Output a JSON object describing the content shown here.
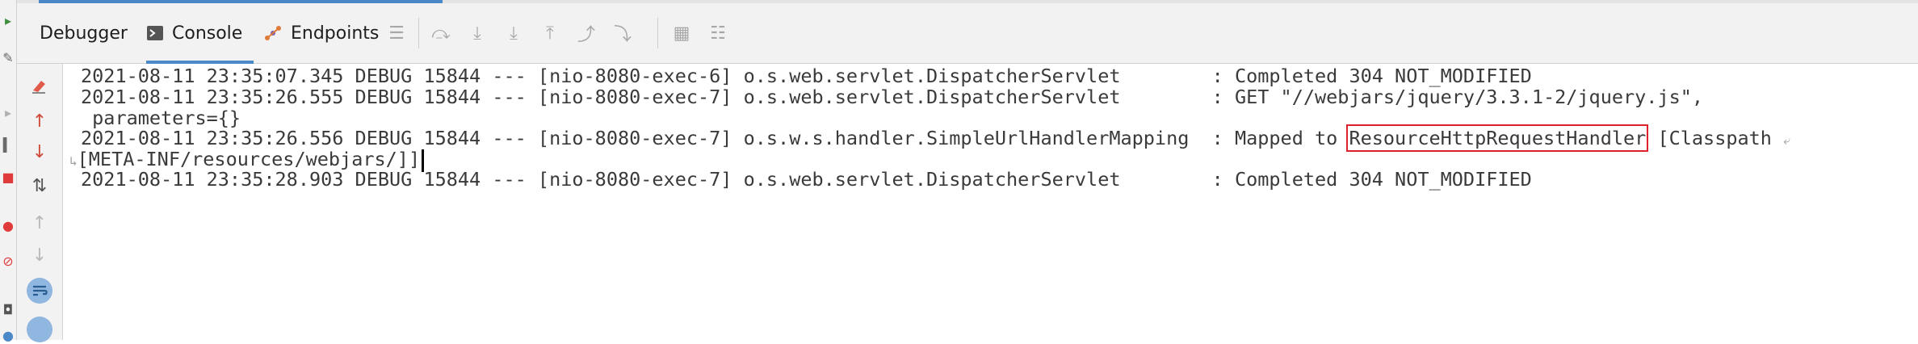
{
  "toolbar": {
    "tabs": [
      {
        "label": "Debugger",
        "active": false
      },
      {
        "label": "Console",
        "active": true,
        "icon": "console-icon"
      },
      {
        "label": "Endpoints",
        "active": false,
        "icon": "endpoints-icon"
      }
    ],
    "buttons": [
      "menu-icon",
      "show-execution-point-icon",
      "step-over-icon",
      "step-into-icon",
      "step-out-icon",
      "drop-frame-icon",
      "run-to-cursor-icon",
      "evaluate-expression-icon",
      "trace-icon"
    ]
  },
  "gutter": {
    "buttons": [
      "clear-all-icon",
      "up-arrow-icon",
      "down-arrow-icon",
      "sort-icon",
      "scroll-up-icon",
      "scroll-down-icon",
      "soft-wrap-icon",
      "scroll-to-end-icon"
    ]
  },
  "console": {
    "lines": [
      {
        "text": "2021-08-11 23:35:07.345 DEBUG 15844 --- [nio-8080-exec-6] o.s.web.servlet.DispatcherServlet        : Completed 304 NOT_MODIFIED"
      },
      {
        "text": "2021-08-11 23:35:26.555 DEBUG 15844 --- [nio-8080-exec-7] o.s.web.servlet.DispatcherServlet        : GET \"//webjars/jquery/3.3.1-2/jquery.js\","
      },
      {
        "text": " parameters={}"
      },
      {
        "pre": "2021-08-11 23:35:26.556 DEBUG 15844 --- [nio-8080-exec-7] o.s.w.s.handler.SimpleUrlHandlerMapping  : Mapped to ",
        "highlight": "ResourceHttpRequestHandler",
        "post": " [Classpath "
      },
      {
        "text": "[META-INF/resources/webjars/]]"
      },
      {
        "text": "2021-08-11 23:35:28.903 DEBUG 15844 --- [nio-8080-exec-7] o.s.web.servlet.DispatcherServlet        : Completed 304 NOT_MODIFIED"
      }
    ]
  },
  "colors": {
    "accent": "#4a88c7",
    "highlight_box": "#e0202c",
    "text": "#3a3a3a",
    "toolbar_bg": "#f2f2f2"
  }
}
